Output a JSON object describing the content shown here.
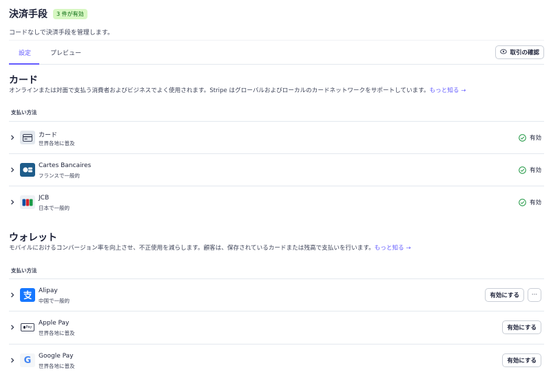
{
  "header": {
    "title": "決済手段",
    "badge": "3 件が有効",
    "subtitle": "コードなしで決済手段を管理します。"
  },
  "tabs": [
    {
      "label": "設定",
      "active": true
    },
    {
      "label": "プレビュー",
      "active": false
    }
  ],
  "confirm_button": {
    "label": "取引の確認",
    "icon": "eye-icon"
  },
  "cards": {
    "title": "カード",
    "description": "オンラインまたは対面で支払う消費者およびビジネスでよく使用されます。Stripe はグローバルおよびローカルのカードネットワークをサポートしています。",
    "learn_more": "もっと知る →",
    "method_header": "支払い方法",
    "items": [
      {
        "name": "カード",
        "sub": "世界各地に普及",
        "status": "有効"
      },
      {
        "name": "Cartes Bancaires",
        "sub": "フランスで一般的",
        "status": "有効"
      },
      {
        "name": "JCB",
        "sub": "日本で一般的",
        "status": "有効"
      }
    ]
  },
  "wallets": {
    "title": "ウォレット",
    "description": "モバイルにおけるコンバージョン率を向上させ、不正使用を減らします。顧客は、保存されているカードまたは残高で支払いを行います。",
    "learn_more": "もっと知る →",
    "method_header": "支払い方法",
    "items": [
      {
        "name": "Alipay",
        "sub": "中国で一般的",
        "action": "有効にする",
        "more": "···"
      },
      {
        "name": "Apple Pay",
        "sub": "世界各地に普及",
        "action": "有効にする",
        "logo_text": "Pay"
      },
      {
        "name": "Google Pay",
        "sub": "世界各地に普及",
        "action": "有効にする",
        "logo_text": "G"
      }
    ]
  },
  "colors": {
    "accent": "#635bff",
    "enabled_green": "#2e9e4f",
    "badge_bg": "#d7f7c2",
    "cb_blue": "#1e5c8a",
    "alipay_blue": "#1677ff"
  }
}
